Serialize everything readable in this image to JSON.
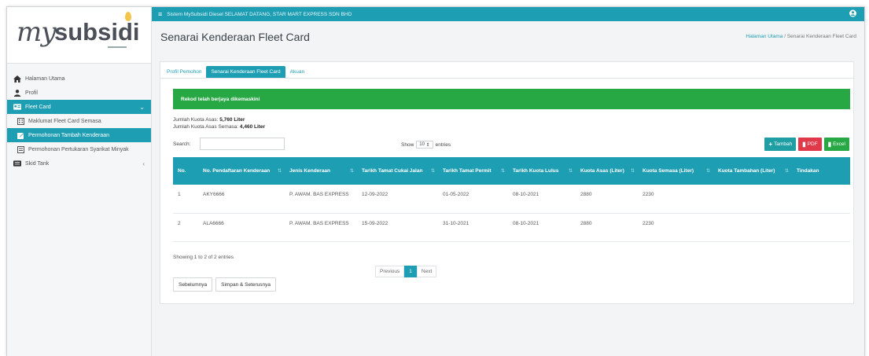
{
  "app": {
    "logo_prefix": "my",
    "logo_main": "subsidi"
  },
  "topbar": {
    "menu_icon": "menu-icon",
    "text": "Sistem MySubsidi Diesel  SELAMAT DATANG, STAR MART EXPRESS SDN BHD",
    "user_icon": "user-icon"
  },
  "sidebar": {
    "items": [
      {
        "label": "Halaman Utama",
        "icon": "home-icon"
      },
      {
        "label": "Profil",
        "icon": "user-icon"
      },
      {
        "label": "Fleet Card",
        "icon": "card-icon"
      },
      {
        "label": "Maklumat Fleet Card Semasa",
        "icon": "building-icon"
      },
      {
        "label": "Permohonan Tambah Kenderaan",
        "icon": "edit-icon"
      },
      {
        "label": "Permohonan Pertukaran Syarikat Minyak",
        "icon": "list-icon"
      },
      {
        "label": "Skid Tank",
        "icon": "tank-icon"
      }
    ]
  },
  "page": {
    "title": "Senarai Kenderaan Fleet Card"
  },
  "breadcrumb": {
    "home": "Halaman Utama",
    "sep": "/",
    "current": "Senarai Kenderaan Fleet Card"
  },
  "tabs": [
    {
      "label": "Profil Pemohon"
    },
    {
      "label": "Senarai Kenderaan Fleet Card"
    },
    {
      "label": "Akuan"
    }
  ],
  "alert": {
    "text": "Rekod telah berjaya dikemaskini"
  },
  "quota": {
    "asas_label": "Jumlah Kuota Asas:",
    "asas_value": "5,760 Liter",
    "semasa_label": "Jumlah Kuota Asas Semasa:",
    "semasa_value": "4,460 Liter"
  },
  "search": {
    "label": "Search:",
    "value": ""
  },
  "show": {
    "prefix": "Show",
    "value": "10",
    "suffix": "entries"
  },
  "buttons": {
    "tambah": "Tambah",
    "pdf": "PDF",
    "excel": "Excel"
  },
  "table": {
    "headers": [
      "No.",
      "No. Pendaftaran Kenderaan",
      "Jenis Kenderaan",
      "Tarikh Tamat Cukai Jalan",
      "Tarikh Tamat Permit",
      "Tarikh Kuota Lulus",
      "Kuota Asas (Liter)",
      "Kuota Semasa (Liter)",
      "Kuota Tambahan (Liter)",
      "Tindakan"
    ],
    "rows": [
      [
        "1",
        "AKY6666",
        "P. AWAM. BAS EXPRESS",
        "12-09-2022",
        "01-05-2022",
        "08-10-2021",
        "2880",
        "2230",
        "",
        ""
      ],
      [
        "2",
        "ALA6666",
        "P. AWAM. BAS EXPRESS",
        "15-09-2022",
        "31-10-2021",
        "08-10-2021",
        "2880",
        "2230",
        "",
        ""
      ]
    ]
  },
  "info": {
    "text": "Showing 1 to 2 of 2 entries"
  },
  "pager": {
    "prev": "Previous",
    "page": "1",
    "next": "Next"
  },
  "footer": {
    "back": "Sebelumnya",
    "save": "Simpan & Seterusnya"
  },
  "colors": {
    "primary": "#1e9eb3",
    "success": "#28a845",
    "danger": "#e0394a"
  }
}
